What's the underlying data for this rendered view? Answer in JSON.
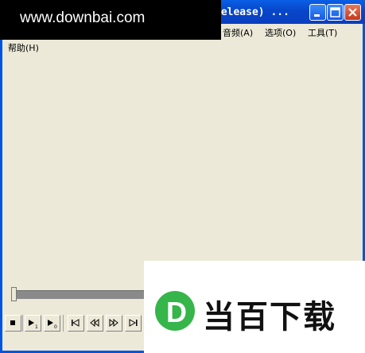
{
  "window": {
    "title_visible": "release) ...",
    "colors": {
      "titlebar": "#0a5fe6",
      "face": "#ece9d8",
      "close": "#d4502f"
    }
  },
  "menus": {
    "audio": {
      "label": "音频",
      "accel": "(A)"
    },
    "options": {
      "label": "选项",
      "accel": "(O)"
    },
    "tools": {
      "label": "工具",
      "accel": "(T)"
    },
    "help": {
      "label": "帮助",
      "accel": "(H)"
    }
  },
  "watermarks": {
    "banner_text": "www.downbai.com",
    "logo_letter": "D",
    "logo_text": "当百下载"
  },
  "playback": {
    "seek_position": 0.0
  },
  "controls": [
    {
      "name": "stop",
      "icon": "stop-icon"
    },
    {
      "name": "play-step",
      "icon": "play-subscript-1-icon"
    },
    {
      "name": "play-alt",
      "icon": "play-subscript-0-icon"
    },
    {
      "name": "skip-back",
      "icon": "skip-back-icon"
    },
    {
      "name": "rewind",
      "icon": "rewind-icon"
    },
    {
      "name": "fast-forward",
      "icon": "fast-forward-icon"
    },
    {
      "name": "skip-forward",
      "icon": "skip-forward-icon"
    }
  ]
}
